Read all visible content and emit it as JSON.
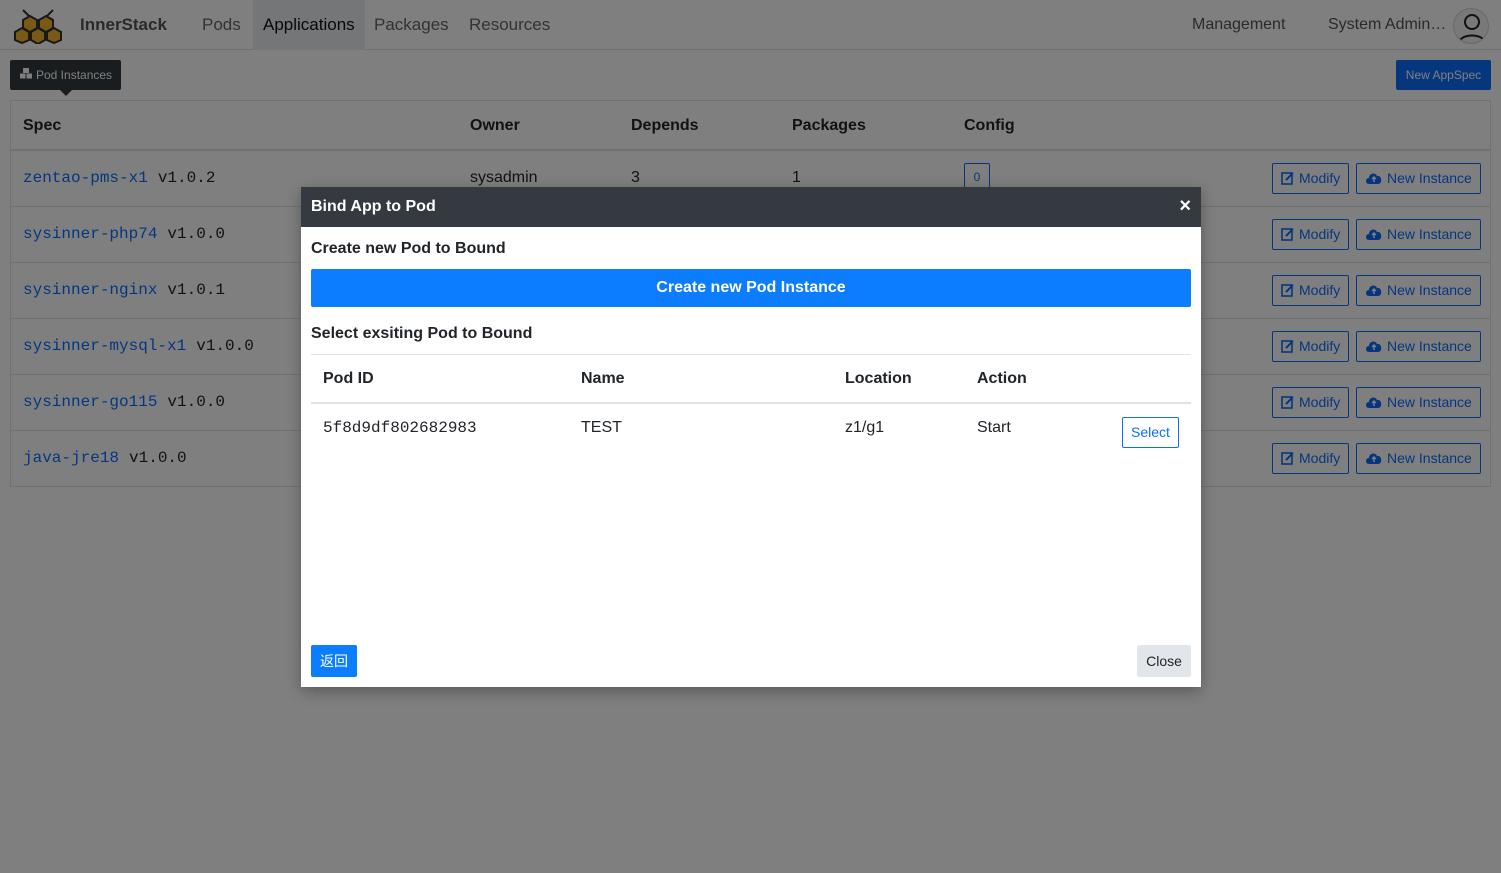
{
  "navbar": {
    "brand": "InnerStack",
    "items": [
      {
        "label": "Pods"
      },
      {
        "label": "Applications",
        "active": true
      },
      {
        "label": "Packages"
      },
      {
        "label": "Resources"
      }
    ],
    "management": "Management",
    "user": "System Admin…"
  },
  "tooltip": {
    "label": "Pod Instances",
    "icon": "cubes-icon"
  },
  "toolbar": {
    "new_appspec": "New AppSpec"
  },
  "table": {
    "headers": {
      "spec": "Spec",
      "owner": "Owner",
      "depends": "Depends",
      "packages": "Packages",
      "config": "Config"
    },
    "rows": [
      {
        "name": "zentao-pms-x1",
        "version": "v1.0.2",
        "owner": "sysadmin",
        "depends": "3",
        "packages": "1",
        "config": "0"
      },
      {
        "name": "sysinner-php74",
        "version": "v1.0.0"
      },
      {
        "name": "sysinner-nginx",
        "version": "v1.0.1"
      },
      {
        "name": "sysinner-mysql-x1",
        "version": "v1.0.0"
      },
      {
        "name": "sysinner-go115",
        "version": "v1.0.0"
      },
      {
        "name": "java-jre18",
        "version": "v1.0.0"
      }
    ],
    "modify_label": "Modify",
    "new_instance_label": "New Instance"
  },
  "modal": {
    "title": "Bind App to Pod",
    "close_symbol": "×",
    "create_section": "Create new Pod to Bound",
    "create_button": "Create new Pod Instance",
    "select_section": "Select exsiting Pod to Bound",
    "pod_headers": {
      "id": "Pod ID",
      "name": "Name",
      "location": "Location",
      "action": "Action"
    },
    "pods": [
      {
        "id": "5f8d9df802682983",
        "name": "TEST",
        "location": "z1/g1",
        "action": "Start",
        "select_label": "Select"
      }
    ],
    "back_button": "返回",
    "close_button": "Close"
  },
  "colors": {
    "primary": "#0d6efd",
    "header_dark": "#343a40"
  }
}
